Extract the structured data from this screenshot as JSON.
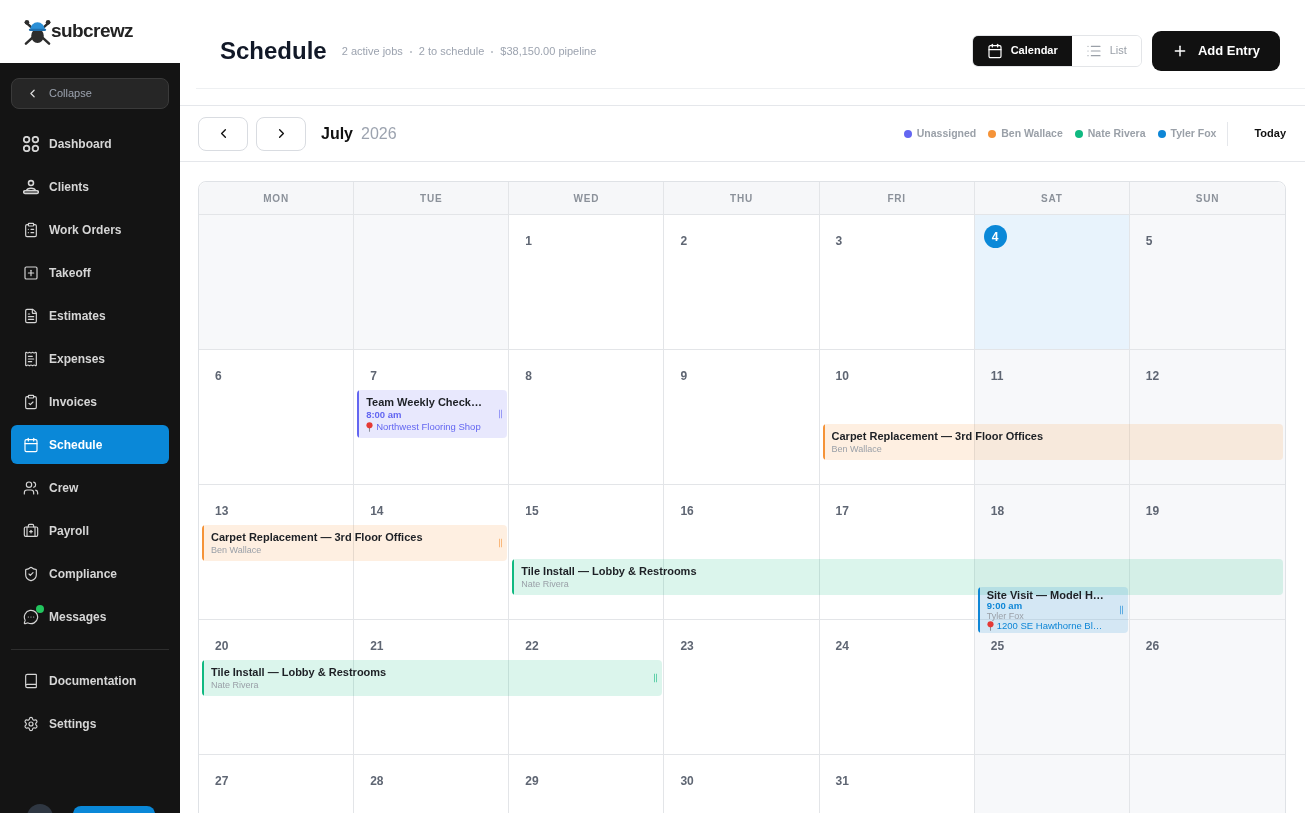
{
  "logo": {
    "text": "subcrewz"
  },
  "sidebar": {
    "collapse_label": "Collapse",
    "items": [
      {
        "label": "Dashboard",
        "selected": false,
        "has_notification": false
      },
      {
        "label": "Clients",
        "selected": false,
        "has_notification": false
      },
      {
        "label": "Work Orders",
        "selected": false,
        "has_notification": false
      },
      {
        "label": "Takeoff",
        "selected": false,
        "has_notification": false
      },
      {
        "label": "Estimates",
        "selected": false,
        "has_notification": false
      },
      {
        "label": "Expenses",
        "selected": false,
        "has_notification": false
      },
      {
        "label": "Invoices",
        "selected": false,
        "has_notification": false
      },
      {
        "label": "Schedule",
        "selected": true,
        "has_notification": false
      },
      {
        "label": "Crew",
        "selected": false,
        "has_notification": false
      },
      {
        "label": "Payroll",
        "selected": false,
        "has_notification": false
      },
      {
        "label": "Compliance",
        "selected": false,
        "has_notification": false
      },
      {
        "label": "Messages",
        "selected": false,
        "has_notification": true
      }
    ],
    "secondary_items": [
      {
        "label": "Documentation",
        "selected": false
      },
      {
        "label": "Settings",
        "selected": false
      }
    ]
  },
  "header": {
    "title": "Schedule",
    "stats": [
      "2 active jobs",
      "2 to schedule",
      "$38,150.00 pipeline"
    ],
    "views": [
      {
        "label": "Calendar",
        "selected": true
      },
      {
        "label": "List",
        "selected": false
      }
    ],
    "add_button": "Add Entry"
  },
  "toolbar": {
    "month": "July",
    "year": "2026",
    "legend": [
      {
        "label": "Unassigned",
        "color": "#6366f1"
      },
      {
        "label": "Ben Wallace",
        "color": "#f59338"
      },
      {
        "label": "Nate Rivera",
        "color": "#10b981"
      },
      {
        "label": "Tyler Fox",
        "color": "#0e86d6"
      }
    ],
    "today_button": "Today"
  },
  "calendar": {
    "weekdays": [
      "MON",
      "TUE",
      "WED",
      "THU",
      "FRI",
      "SAT",
      "SUN"
    ],
    "weeks": [
      {
        "days": [
          {
            "kind": "blank"
          },
          {
            "kind": "blank"
          },
          {
            "kind": "day",
            "day": "1",
            "today": false
          },
          {
            "kind": "day",
            "day": "2",
            "today": false
          },
          {
            "kind": "day",
            "day": "3",
            "today": false
          },
          {
            "kind": "day",
            "day": "4",
            "today": true
          },
          {
            "kind": "day",
            "day": "5",
            "today": false
          }
        ]
      },
      {
        "days": [
          {
            "kind": "day",
            "day": "6",
            "today": false
          },
          {
            "kind": "day",
            "day": "7",
            "today": false,
            "events": [
              {
                "kind": "event",
                "title": "Team Weekly Check…",
                "time": "8:00 am",
                "location": "Northwest Flooring Shop",
                "color": "#6366f1"
              }
            ]
          },
          {
            "kind": "day",
            "day": "8",
            "today": false
          },
          {
            "kind": "day",
            "day": "9",
            "today": false
          },
          {
            "kind": "day",
            "day": "10",
            "today": false,
            "events": [
              {
                "kind": "gap"
              },
              {
                "kind": "event",
                "title": "Carpet Replacement — 3rd Floor Offices",
                "assignee": "Ben Wallace",
                "color": "#f59338"
              }
            ]
          },
          {
            "kind": "day",
            "day": "11",
            "today": false,
            "events": [
              {
                "kind": "gap"
              },
              {
                "kind": "continued"
              }
            ]
          },
          {
            "kind": "day",
            "day": "12",
            "today": false,
            "events": [
              {
                "kind": "gap"
              },
              {
                "kind": "continued"
              }
            ]
          }
        ]
      },
      {
        "days": [
          {
            "kind": "day",
            "day": "13",
            "today": false,
            "events": [
              {
                "kind": "event",
                "title": "Carpet Replacement — 3rd Floor Offices",
                "assignee": "Ben Wallace",
                "color": "#f59338"
              }
            ]
          },
          {
            "kind": "day",
            "day": "14",
            "today": false,
            "events": [
              {
                "kind": "continued"
              }
            ]
          },
          {
            "kind": "day",
            "day": "15",
            "today": false,
            "events": [
              {
                "kind": "gap"
              },
              {
                "kind": "event",
                "title": "Tile Install — Lobby & Restrooms",
                "assignee": "Nate Rivera",
                "color": "#10b981"
              }
            ]
          },
          {
            "kind": "day",
            "day": "16",
            "today": false,
            "events": [
              {
                "kind": "gap"
              },
              {
                "kind": "continued"
              }
            ]
          },
          {
            "kind": "day",
            "day": "17",
            "today": false,
            "events": [
              {
                "kind": "gap"
              },
              {
                "kind": "continued"
              }
            ]
          },
          {
            "kind": "day",
            "day": "18",
            "today": false,
            "events": [
              {
                "kind": "gap"
              },
              {
                "kind": "continued"
              },
              {
                "kind": "event",
                "title": "Site Visit — Model H…",
                "time": "9:00 am",
                "assignee": "Tyler Fox",
                "location": "1200 SE Hawthorne Bl…",
                "color": "#0e86d6"
              }
            ]
          },
          {
            "kind": "day",
            "day": "19",
            "today": false,
            "events": [
              {
                "kind": "gap"
              },
              {
                "kind": "continued"
              }
            ]
          }
        ]
      },
      {
        "days": [
          {
            "kind": "day",
            "day": "20",
            "today": false,
            "events": [
              {
                "kind": "event",
                "title": "Tile Install — Lobby & Restrooms",
                "assignee": "Nate Rivera",
                "color": "#10b981"
              }
            ]
          },
          {
            "kind": "day",
            "day": "21",
            "today": false,
            "events": [
              {
                "kind": "continued"
              }
            ]
          },
          {
            "kind": "day",
            "day": "22",
            "today": false,
            "events": [
              {
                "kind": "continued"
              }
            ]
          },
          {
            "kind": "day",
            "day": "23",
            "today": false
          },
          {
            "kind": "day",
            "day": "24",
            "today": false
          },
          {
            "kind": "day",
            "day": "25",
            "today": false
          },
          {
            "kind": "day",
            "day": "26",
            "today": false
          }
        ]
      },
      {
        "days": [
          {
            "kind": "day",
            "day": "27",
            "today": false
          },
          {
            "kind": "day",
            "day": "28",
            "today": false
          },
          {
            "kind": "day",
            "day": "29",
            "today": false
          },
          {
            "kind": "day",
            "day": "30",
            "today": false
          },
          {
            "kind": "day",
            "day": "31",
            "today": false
          },
          {
            "kind": "blank"
          },
          {
            "kind": "blank"
          }
        ]
      }
    ]
  }
}
